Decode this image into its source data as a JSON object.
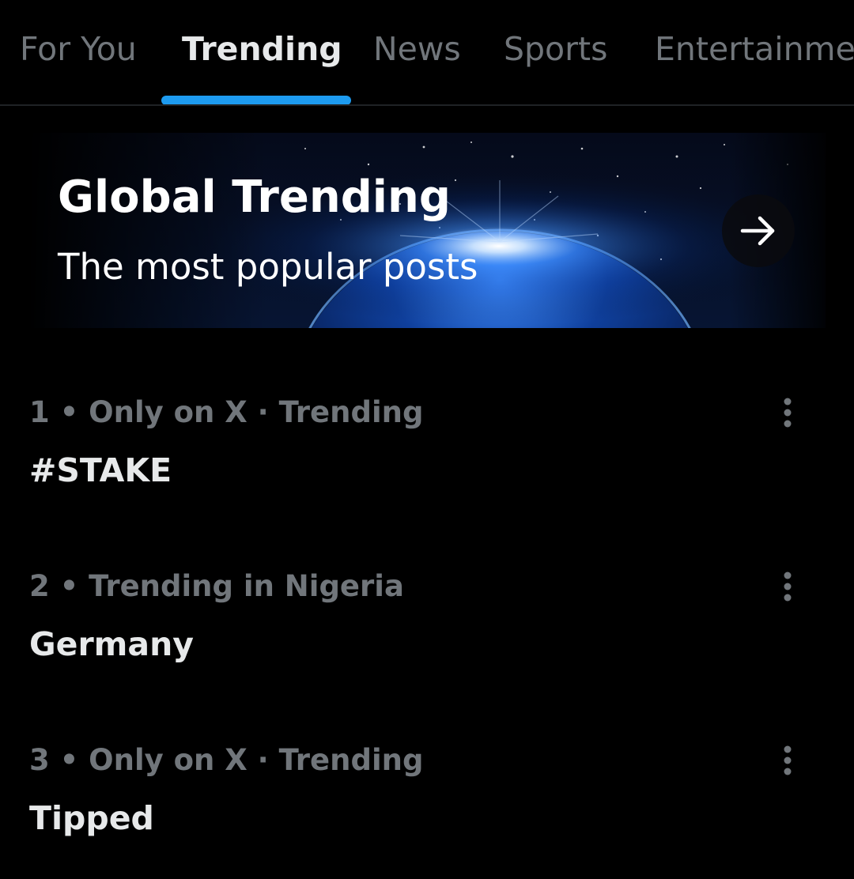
{
  "tabs": [
    {
      "label": "For You",
      "active": false
    },
    {
      "label": "Trending",
      "active": true
    },
    {
      "label": "News",
      "active": false
    },
    {
      "label": "Sports",
      "active": false
    },
    {
      "label": "Entertainment",
      "active": false
    }
  ],
  "banner": {
    "title": "Global Trending",
    "subtitle": "The most popular posts",
    "arrow_icon": "arrow-right-icon"
  },
  "trends": [
    {
      "meta": "1 • Only on X · Trending",
      "name": "#STAKE",
      "more_icon": "more-vertical-icon"
    },
    {
      "meta": "2 • Trending in Nigeria",
      "name": "Germany",
      "more_icon": "more-vertical-icon"
    },
    {
      "meta": "3 • Only on X · Trending",
      "name": "Tipped",
      "more_icon": "more-vertical-icon"
    }
  ],
  "colors": {
    "background": "#000000",
    "accent": "#1d9bf0",
    "muted_text": "#71767b",
    "primary_text": "#e7e9ea"
  }
}
